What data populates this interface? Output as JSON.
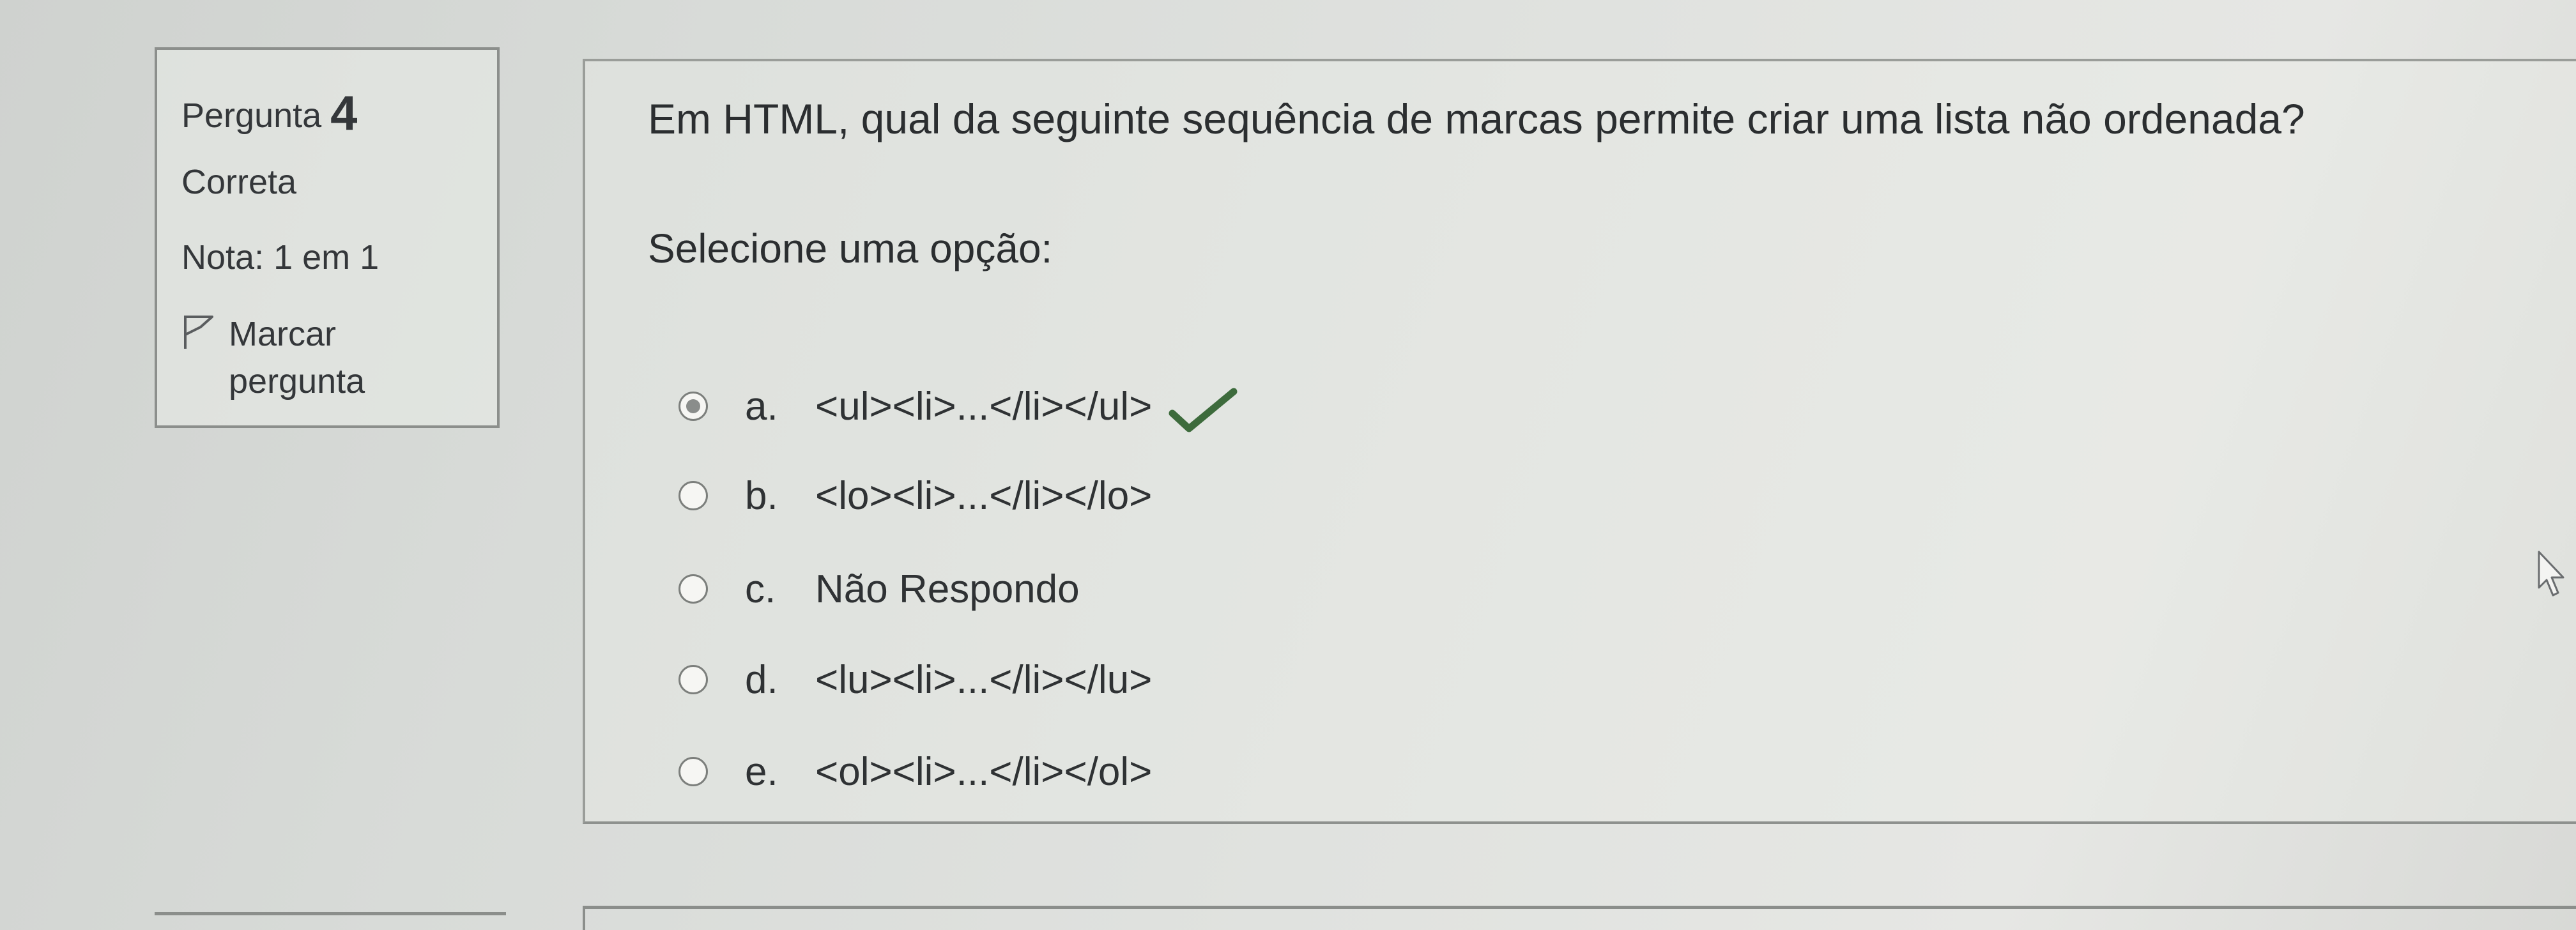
{
  "info": {
    "question_label": "Pergunta",
    "question_number": "4",
    "state": "Correta",
    "grade": "Nota: 1 em 1",
    "flag_label_line1": "Marcar",
    "flag_label_line2": "pergunta"
  },
  "question": {
    "text": "Em HTML, qual da seguinte sequência de marcas permite criar uma lista não ordenada?",
    "prompt": "Selecione uma opção:",
    "options": [
      {
        "letter": "a.",
        "text": "<ul><li>...</li></ul>",
        "selected": true,
        "correct": true
      },
      {
        "letter": "b.",
        "text": "<lo><li>...</li></lo>",
        "selected": false
      },
      {
        "letter": "c.",
        "text": "Não Respondo",
        "selected": false
      },
      {
        "letter": "d.",
        "text": "<lu><li>...</li></lu>",
        "selected": false
      },
      {
        "letter": "e.",
        "text": "<ol><li>...</li></ol>",
        "selected": false
      }
    ]
  },
  "icons": {
    "flag": "flag-icon",
    "correct": "check-icon",
    "cursor": "mouse-pointer-icon"
  },
  "colors": {
    "correct_check": "#3d6b3c",
    "text": "#2f3234",
    "border": "#8c8f8c"
  }
}
